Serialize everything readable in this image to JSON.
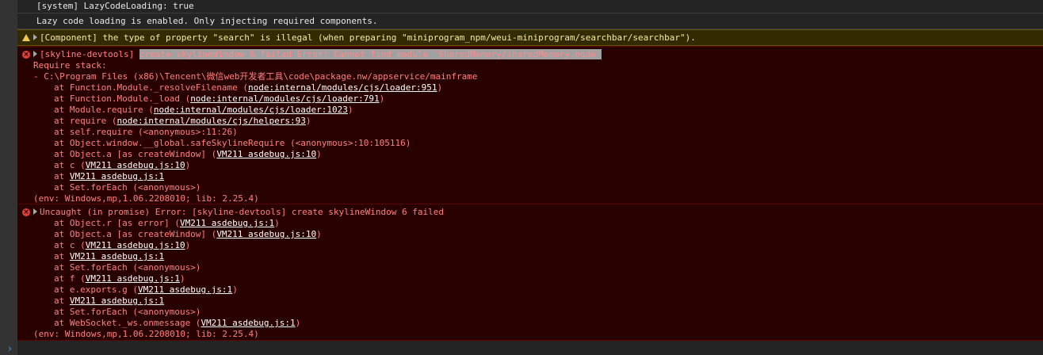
{
  "messages": {
    "system": "[system] LazyCodeLoading: true",
    "lazy": "Lazy code loading is enabled. Only injecting required components.",
    "warning": "[Component] the type of property \"search\" is illegal (when preparing \"miniprogram_npm/weui-miniprogram/searchbar/searchbar\")."
  },
  "error1": {
    "prefix": "[skyline-devtools] ",
    "selected": "create skylineWindow 6 failed Error: Cannot find module 'SharedMemory/sharedMemory.node'",
    "require_stack": "Require stack:",
    "path": "- C:\\Program Files (x86)\\Tencent\\微信web开发者工具\\code\\package.nw/appservice/mainframe",
    "f1": {
      "pre": "at Function.Module._resolveFilename (",
      "link": "node:internal/modules/cjs/loader:951",
      "post": ")"
    },
    "f2": {
      "pre": "at Function.Module._load (",
      "link": "node:internal/modules/cjs/loader:791",
      "post": ")"
    },
    "f3": {
      "pre": "at Module.require (",
      "link": "node:internal/modules/cjs/loader:1023",
      "post": ")"
    },
    "f4": {
      "pre": "at require (",
      "link": "node:internal/modules/cjs/helpers:93",
      "post": ")"
    },
    "f5": "at self.require (<anonymous>:11:26)",
    "f6": "at Object.window.__global.safeSkylineRequire (<anonymous>:10:105116)",
    "f7": {
      "pre": "at Object.a [as createWindow] (",
      "link": "VM211 asdebug.js:10",
      "post": ")"
    },
    "f8": {
      "pre": "at c (",
      "link": "VM211 asdebug.js:10",
      "post": ")"
    },
    "f9": {
      "pre": "at ",
      "link": "VM211 asdebug.js:1",
      "post": ""
    },
    "f10": "at Set.forEach (<anonymous>)",
    "env": "(env: Windows,mp,1.06.2208010; lib: 2.25.4)"
  },
  "error2": {
    "header": "Uncaught (in promise) Error: [skyline-devtools] create skylineWindow 6 failed",
    "f1": {
      "pre": "at Object.r [as error] (",
      "link": "VM211 asdebug.js:1",
      "post": ")"
    },
    "f2": {
      "pre": "at Object.a [as createWindow] (",
      "link": "VM211 asdebug.js:10",
      "post": ")"
    },
    "f3": {
      "pre": "at c (",
      "link": "VM211 asdebug.js:10",
      "post": ")"
    },
    "f4": {
      "pre": "at ",
      "link": "VM211 asdebug.js:1",
      "post": ""
    },
    "f5": "at Set.forEach (<anonymous>)",
    "f6": {
      "pre": "at f (",
      "link": "VM211 asdebug.js:1",
      "post": ")"
    },
    "f7": {
      "pre": "at e.exports.g (",
      "link": "VM211 asdebug.js:1",
      "post": ")"
    },
    "f8": {
      "pre": "at ",
      "link": "VM211 asdebug.js:1",
      "post": ""
    },
    "f9": "at Set.forEach (<anonymous>)",
    "f10": {
      "pre": "at WebSocket._ws.onmessage (",
      "link": "VM211 asdebug.js:1",
      "post": ")"
    },
    "env": "(env: Windows,mp,1.06.2208010; lib: 2.25.4)"
  },
  "prompt_symbol": "›"
}
